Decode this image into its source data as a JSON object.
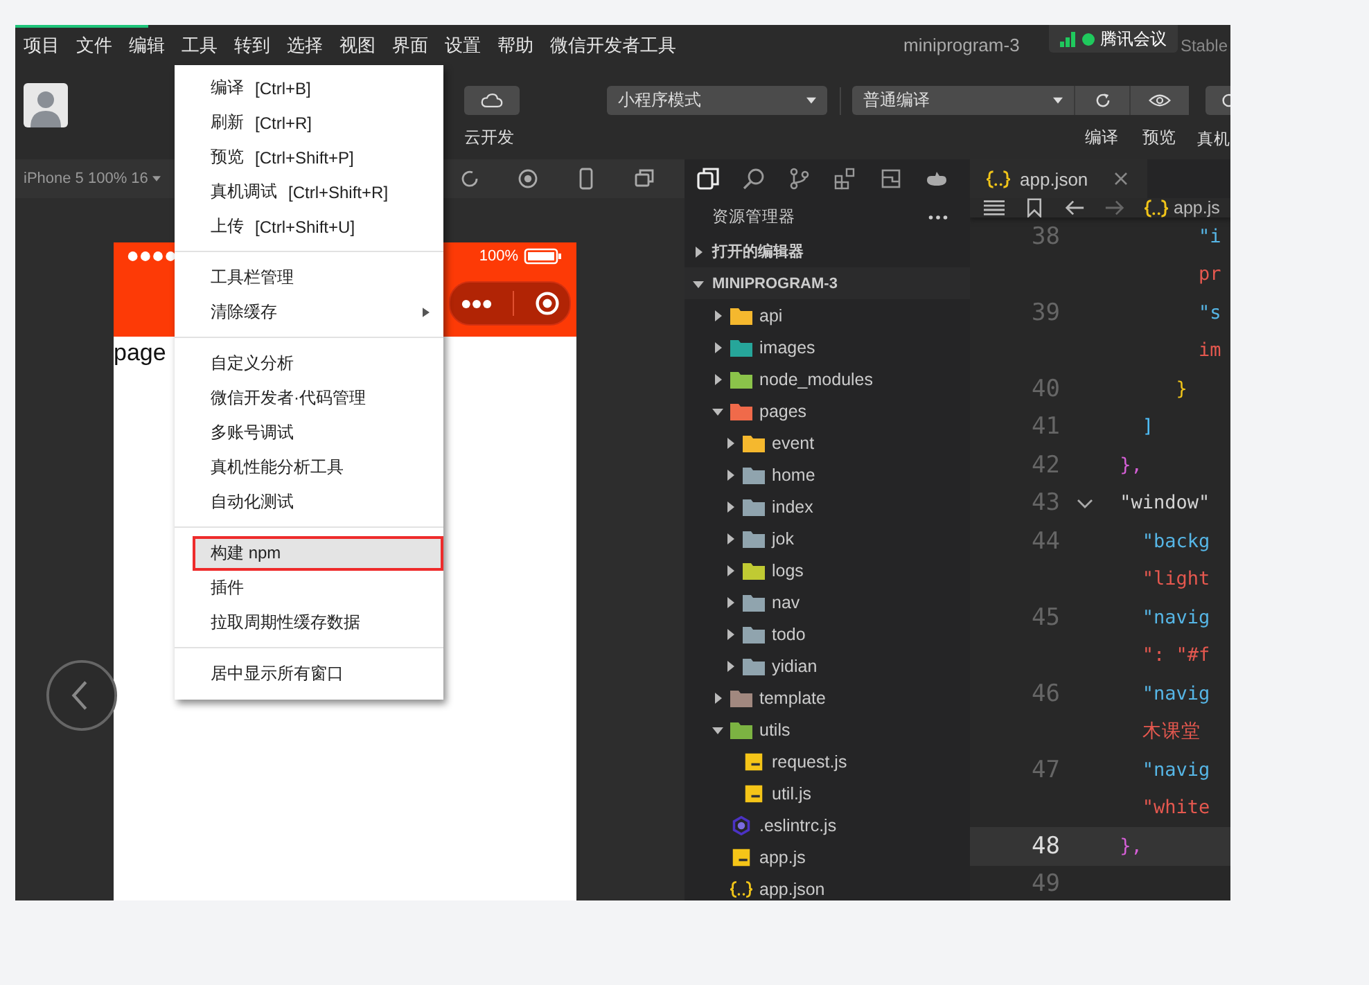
{
  "load_bar": {
    "level": 0.11
  },
  "menubar": [
    "项目",
    "文件",
    "编辑",
    "工具",
    "转到",
    "选择",
    "视图",
    "界面",
    "设置",
    "帮助",
    "微信开发者工具"
  ],
  "title": "miniprogram-3",
  "title_suffix": "Stable",
  "meeting": {
    "label": "腾讯会议"
  },
  "toolbar": {
    "cloud_label": "云开发",
    "mode": "小程序模式",
    "compile": "普通编译",
    "labels": [
      "编译",
      "预览",
      "真机"
    ]
  },
  "simulator": {
    "device": "iPhone 5 100% 16",
    "battery": "100%",
    "page_text": "page"
  },
  "menu": {
    "groups": [
      [
        {
          "label": "编译",
          "shortcut": "[Ctrl+B]",
          "submenu": false,
          "selected": false,
          "marked": false
        },
        {
          "label": "刷新",
          "shortcut": "[Ctrl+R]",
          "submenu": false,
          "selected": false,
          "marked": false
        },
        {
          "label": "预览",
          "shortcut": "[Ctrl+Shift+P]",
          "submenu": false,
          "selected": false,
          "marked": false
        },
        {
          "label": "真机调试",
          "shortcut": "[Ctrl+Shift+R]",
          "submenu": false,
          "selected": false,
          "marked": false
        },
        {
          "label": "上传",
          "shortcut": "[Ctrl+Shift+U]",
          "submenu": false,
          "selected": false,
          "marked": false
        }
      ],
      [
        {
          "label": "工具栏管理",
          "submenu": false,
          "selected": false,
          "marked": false
        },
        {
          "label": "清除缓存",
          "submenu": true,
          "selected": false,
          "marked": false
        }
      ],
      [
        {
          "label": "自定义分析",
          "submenu": false,
          "selected": false,
          "marked": false
        },
        {
          "label": "微信开发者·代码管理",
          "submenu": false,
          "selected": false,
          "marked": false
        },
        {
          "label": "多账号调试",
          "submenu": false,
          "selected": false,
          "marked": false
        },
        {
          "label": "真机性能分析工具",
          "submenu": false,
          "selected": false,
          "marked": false
        },
        {
          "label": "自动化测试",
          "submenu": false,
          "selected": false,
          "marked": false
        }
      ],
      [
        {
          "label": "构建 npm",
          "submenu": false,
          "selected": true,
          "marked": true
        },
        {
          "label": "插件",
          "submenu": false,
          "selected": false,
          "marked": false
        },
        {
          "label": "拉取周期性缓存数据",
          "submenu": false,
          "selected": false,
          "marked": false
        }
      ],
      [
        {
          "label": "居中显示所有窗口",
          "submenu": false,
          "selected": false,
          "marked": false
        }
      ]
    ]
  },
  "explorer": {
    "title": "资源管理器",
    "sections": [
      {
        "label": "打开的编辑器",
        "expanded": false
      },
      {
        "label": "MINIPROGRAM-3",
        "expanded": true,
        "children": [
          {
            "name": "api",
            "kind": "folder",
            "color": "#f5b82e",
            "expanded": false
          },
          {
            "name": "images",
            "kind": "folder",
            "color": "#26a69a",
            "expanded": false
          },
          {
            "name": "node_modules",
            "kind": "folder",
            "color": "#8bc34a",
            "expanded": false
          },
          {
            "name": "pages",
            "kind": "folder",
            "color": "#f06a4a",
            "expanded": true,
            "children": [
              {
                "name": "event",
                "kind": "folder",
                "color": "#f5b82e",
                "expanded": false
              },
              {
                "name": "home",
                "kind": "folder",
                "color": "#90a4ae",
                "expanded": false
              },
              {
                "name": "index",
                "kind": "folder",
                "color": "#90a4ae",
                "expanded": false
              },
              {
                "name": "jok",
                "kind": "folder",
                "color": "#90a4ae",
                "expanded": false
              },
              {
                "name": "logs",
                "kind": "folder",
                "color": "#c0ca33",
                "expanded": false
              },
              {
                "name": "nav",
                "kind": "folder",
                "color": "#90a4ae",
                "expanded": false
              },
              {
                "name": "todo",
                "kind": "folder",
                "color": "#90a4ae",
                "expanded": false
              },
              {
                "name": "yidian",
                "kind": "folder",
                "color": "#90a4ae",
                "expanded": false
              }
            ]
          },
          {
            "name": "template",
            "kind": "folder",
            "color": "#a1887f",
            "expanded": false
          },
          {
            "name": "utils",
            "kind": "folder",
            "color": "#7cb342",
            "expanded": true,
            "children": [
              {
                "name": "request.js",
                "kind": "js"
              },
              {
                "name": "util.js",
                "kind": "js"
              }
            ]
          },
          {
            "name": ".eslintrc.js",
            "kind": "eslint"
          },
          {
            "name": "app.js",
            "kind": "js"
          },
          {
            "name": "app.json",
            "kind": "json"
          }
        ]
      }
    ]
  },
  "editor": {
    "tab": "app.json",
    "breadcrumb": "app.js",
    "rows": [
      {
        "num": "38",
        "text": "        \"i",
        "kind": "key",
        "current": false,
        "fold": false
      },
      {
        "text": "        pr",
        "kind": "value",
        "current": false,
        "fold": false
      },
      {
        "num": "39",
        "text": "        \"s",
        "kind": "key",
        "current": false,
        "fold": false
      },
      {
        "text": "        im",
        "kind": "value",
        "current": false,
        "fold": false
      },
      {
        "num": "40",
        "text": "      }",
        "kind": "brace",
        "current": false,
        "fold": false
      },
      {
        "num": "41",
        "text": "   ]",
        "kind": "bracket",
        "current": false,
        "fold": false
      },
      {
        "num": "42",
        "text": " },",
        "kind": "object",
        "current": false,
        "fold": false
      },
      {
        "num": "43",
        "text": " \"window\"",
        "kind": "plain",
        "current": false,
        "fold": true
      },
      {
        "num": "44",
        "text": "   \"backg",
        "kind": "key",
        "current": false,
        "fold": false
      },
      {
        "text": "   \"light",
        "kind": "value",
        "current": false,
        "fold": false
      },
      {
        "num": "45",
        "text": "   \"navig",
        "kind": "key",
        "current": false,
        "fold": false
      },
      {
        "text": "   \": \"#f",
        "kind": "value",
        "current": false,
        "fold": false
      },
      {
        "num": "46",
        "text": "   \"navig",
        "kind": "key",
        "current": false,
        "fold": false
      },
      {
        "text": "   木课堂",
        "kind": "value",
        "current": false,
        "fold": false
      },
      {
        "num": "47",
        "text": "   \"navig",
        "kind": "key",
        "current": false,
        "fold": false
      },
      {
        "text": "   \"white",
        "kind": "value",
        "current": false,
        "fold": false
      },
      {
        "num": "48",
        "text": " },",
        "kind": "object",
        "current": true,
        "fold": false
      },
      {
        "num": "49",
        "current": false,
        "fold": false
      }
    ]
  }
}
